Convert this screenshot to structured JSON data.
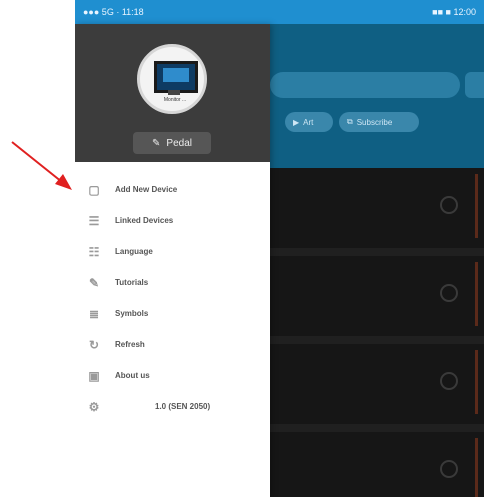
{
  "status_bar": {
    "left": "●●● 5G · 11:18",
    "right": "■■ ■ 12:00"
  },
  "background": {
    "chips": [
      {
        "icon": "▶",
        "label": "Art"
      },
      {
        "icon": "⧉",
        "label": "Subscribe"
      }
    ],
    "rows": 4
  },
  "drawer": {
    "avatar_caption": "Monitor ...",
    "pedal_button_label": "Pedal",
    "menu": [
      {
        "name": "add-new-device",
        "icon": "▢",
        "label": "Add New Device"
      },
      {
        "name": "linked-devices",
        "icon": "☰",
        "label": "Linked Devices"
      },
      {
        "name": "language",
        "icon": "☷",
        "label": "Language"
      },
      {
        "name": "tutorials",
        "icon": "✎",
        "label": "Tutorials"
      },
      {
        "name": "symbols",
        "icon": "≣",
        "label": "Symbols"
      },
      {
        "name": "refresh",
        "icon": "↻",
        "label": "Refresh"
      },
      {
        "name": "about-us",
        "icon": "▣",
        "label": "About us"
      }
    ],
    "version": {
      "icon": "⚙",
      "label": "1.0 (SEN 2050)"
    }
  },
  "colors": {
    "accent": "#1f8fd0",
    "header": "#3c3c3c",
    "arrow": "#e02020"
  }
}
